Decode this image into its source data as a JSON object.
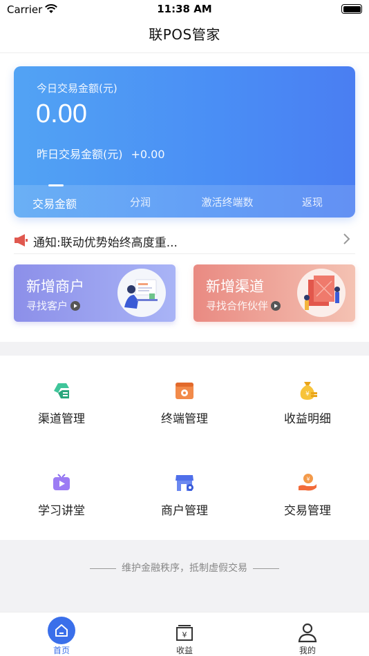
{
  "status_bar": {
    "carrier": "Carrier",
    "time": "11:38 AM"
  },
  "nav": {
    "title": "联POS管家"
  },
  "card": {
    "today_label": "今日交易金额(元)",
    "today_amount": "0.00",
    "yesterday_label": "昨日交易金额(元)",
    "yesterday_amount": "+0.00",
    "tabs": [
      "交易金额",
      "分润",
      "激活终端数",
      "返现"
    ],
    "active_tab": 0
  },
  "notice": {
    "text": "通知:联动优势始终高度重..."
  },
  "promos": [
    {
      "title": "新增商户",
      "subtitle": "寻找客户"
    },
    {
      "title": "新增渠道",
      "subtitle": "寻找合作伙伴"
    }
  ],
  "grid": [
    {
      "label": "渠道管理",
      "icon": "channel-icon"
    },
    {
      "label": "终端管理",
      "icon": "terminal-icon"
    },
    {
      "label": "收益明细",
      "icon": "money-bag-icon"
    },
    {
      "label": "学习讲堂",
      "icon": "tv-play-icon"
    },
    {
      "label": "商户管理",
      "icon": "store-icon"
    },
    {
      "label": "交易管理",
      "icon": "coin-hand-icon"
    }
  ],
  "footer": {
    "slogan": "维护金融秩序，抵制虚假交易"
  },
  "tabbar": [
    {
      "label": "首页",
      "icon": "home-icon",
      "active": true
    },
    {
      "label": "收益",
      "icon": "wallet-icon",
      "active": false
    },
    {
      "label": "我的",
      "icon": "user-icon",
      "active": false
    }
  ],
  "colors": {
    "primary": "#3a6fea",
    "card_start": "#52a3f4",
    "card_end": "#4a7ef2"
  }
}
